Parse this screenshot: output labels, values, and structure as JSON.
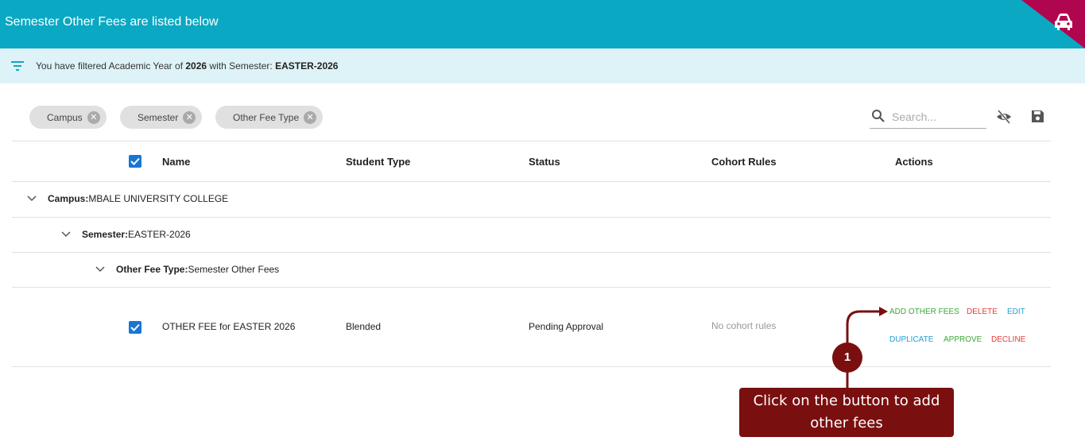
{
  "header": {
    "title": "Semester Other Fees are listed below",
    "car_icon": "car-icon"
  },
  "filter_bar": {
    "prefix": "You have filtered Academic Year of ",
    "year": "2026",
    "middle": " with Semester: ",
    "semester": "EASTER-2026"
  },
  "chips": [
    {
      "label": "Campus"
    },
    {
      "label": "Semester"
    },
    {
      "label": "Other Fee Type"
    }
  ],
  "search": {
    "placeholder": "Search..."
  },
  "table": {
    "headers": {
      "name": "Name",
      "student_type": "Student Type",
      "status": "Status",
      "cohort_rules": "Cohort Rules",
      "actions": "Actions"
    },
    "groups": {
      "campus": {
        "label": "Campus:",
        "value": " MBALE UNIVERSITY COLLEGE"
      },
      "semester": {
        "label": "Semester:",
        "value": " EASTER-2026"
      },
      "fee_type": {
        "label": "Other Fee Type:",
        "value": " Semester Other Fees"
      }
    },
    "row": {
      "name": "OTHER FEE for EASTER 2026",
      "student_type": "Blended",
      "status": "Pending Approval",
      "cohort_rules": "No cohort rules",
      "actions": {
        "add_other_fees": "ADD OTHER FEES",
        "delete": "DELETE",
        "edit": "EDIT",
        "duplicate": "DUPLICATE",
        "approve": "APPROVE",
        "decline": "DECLINE"
      }
    }
  },
  "callout": {
    "number": "1",
    "text": "Click on the button to add other fees"
  },
  "colors": {
    "header": "#0aa8c3",
    "corner": "#b0064f",
    "filter_bg": "#def3f8",
    "callout": "#7a0f10",
    "checkbox": "#1976d2"
  }
}
